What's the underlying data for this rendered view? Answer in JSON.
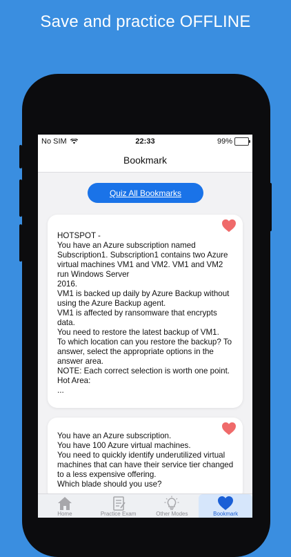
{
  "promo": {
    "headline": "Save and practice OFFLINE"
  },
  "statusbar": {
    "carrier": "No SIM",
    "time": "22:33",
    "battery": "99%"
  },
  "header": {
    "title": "Bookmark"
  },
  "actions": {
    "quiz_all": "Quiz All Bookmarks"
  },
  "cards": [
    {
      "text": "HOTSPOT -\nYou have an Azure subscription named Subscription1. Subscription1 contains two Azure virtual machines VM1 and VM2. VM1 and VM2 run Windows Server\n2016.\nVM1 is backed up daily by Azure Backup without using the Azure Backup agent.\nVM1 is affected by ransomware that encrypts data.\nYou need to restore the latest backup of VM1.\nTo which location can you restore the backup? To answer, select the appropriate options in the answer area.\nNOTE: Each correct selection is worth one point.\nHot Area:\n ...",
      "bookmarked": true
    },
    {
      "text": "You have an Azure subscription.\nYou have 100 Azure virtual machines.\nYou need to quickly identify underutilized virtual machines that can have their service tier changed to a less expensive offering.\nWhich blade should you use?",
      "bookmarked": true
    }
  ],
  "tabs": [
    {
      "label": "Home",
      "icon": "home-icon"
    },
    {
      "label": "Practice Exam",
      "icon": "exam-icon"
    },
    {
      "label": "Other Modes",
      "icon": "lightbulb-icon"
    },
    {
      "label": "Bookmark",
      "icon": "heart-icon",
      "active": true
    }
  ],
  "colors": {
    "background": "#3a8ee0",
    "accent": "#1a73e8",
    "heart": "#ef6a6a"
  }
}
